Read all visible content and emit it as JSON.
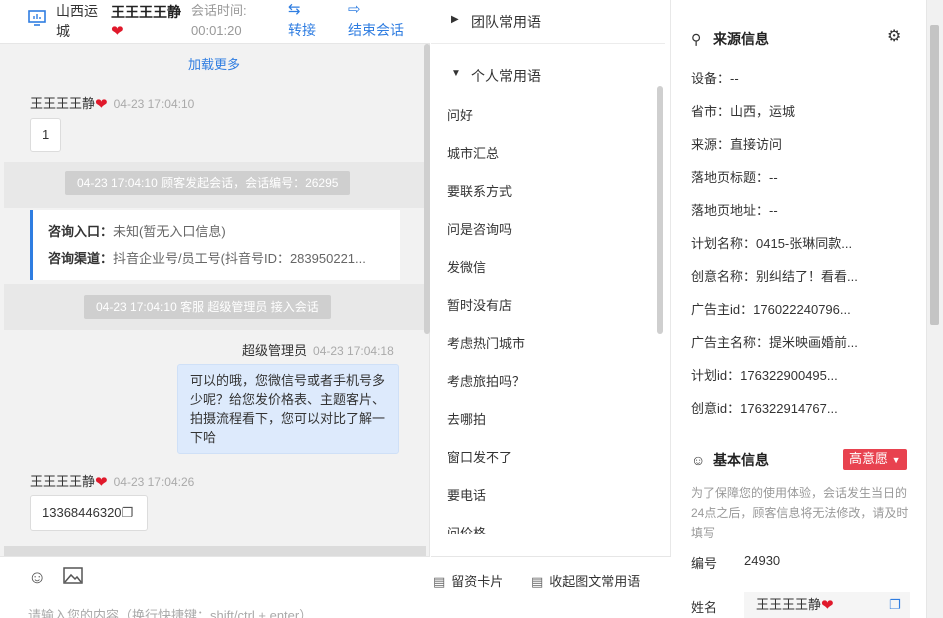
{
  "header": {
    "location": "山西运城",
    "visitor_name": "王王王王静",
    "session_time_label": "会话时间:",
    "session_time": "00:01:20",
    "transfer_label": "转接",
    "end_label": "结束会话"
  },
  "chat": {
    "load_more": "加载更多",
    "messages": [
      {
        "sender": "王王王王静",
        "time": "04-23 17:04:10",
        "text": "1"
      },
      {
        "system": "04-23 17:04:10 顾客发起会话，会话编号：26295"
      },
      {
        "entry_label": "咨询入口：",
        "entry_value": "未知(暂无入口信息)",
        "channel_label": "咨询渠道：",
        "channel_value": "抖音企业号/员工号(抖音号ID：283950221..."
      },
      {
        "system": "04-23 17:04:10 客服 超级管理员 接入会话"
      },
      {
        "sender": "超级管理员",
        "time": "04-23 17:04:18",
        "text": "可以的哦，您微信号或者手机号多少呢？给您发价格表、主题客片、拍摄流程看下，您可以对比了解一下哈"
      },
      {
        "sender": "王王王王静",
        "time": "04-23 17:04:26",
        "text": "13368446320"
      }
    ],
    "input_placeholder": "请输入您的内容（换行快捷键：shift/ctrl + enter）"
  },
  "phrases": {
    "team_group": "团队常用语",
    "personal_group": "个人常用语",
    "items": [
      "问好",
      "城市汇总",
      "要联系方式",
      "问是咨询吗",
      "发微信",
      "暂时没有店",
      "考虑热门城市",
      "考虑旅拍吗？",
      "去哪拍",
      "窗口发不了",
      "要电话",
      "问价格"
    ],
    "leave_card": "留资卡片",
    "collect_label": "收起图文常用语"
  },
  "info": {
    "source_title": "来源信息",
    "source_rows": [
      {
        "k": "设备：",
        "v": "--"
      },
      {
        "k": "省市：",
        "v": "山西，运城"
      },
      {
        "k": "来源：",
        "v": "直接访问"
      },
      {
        "k": "落地页标题：",
        "v": "--"
      },
      {
        "k": "落地页地址：",
        "v": "--"
      },
      {
        "k": "计划名称：",
        "v": "0415-张琳同款..."
      },
      {
        "k": "创意名称：",
        "v": "别纠结了！看看..."
      },
      {
        "k": "广告主id：",
        "v": "176022240796..."
      },
      {
        "k": "广告主名称：",
        "v": "提米映画婚前..."
      },
      {
        "k": "计划id：",
        "v": "176322900495..."
      },
      {
        "k": "创意id：",
        "v": "176322914767..."
      }
    ],
    "basic_title": "基本信息",
    "intent_badge": "高意愿",
    "notice": "为了保障您的使用体验，会话发生当日的24点之后，顾客信息将无法修改，请及时填写",
    "id_label": "编号",
    "id_value": "24930",
    "name_label": "姓名",
    "name_value": "王王王王静"
  }
}
